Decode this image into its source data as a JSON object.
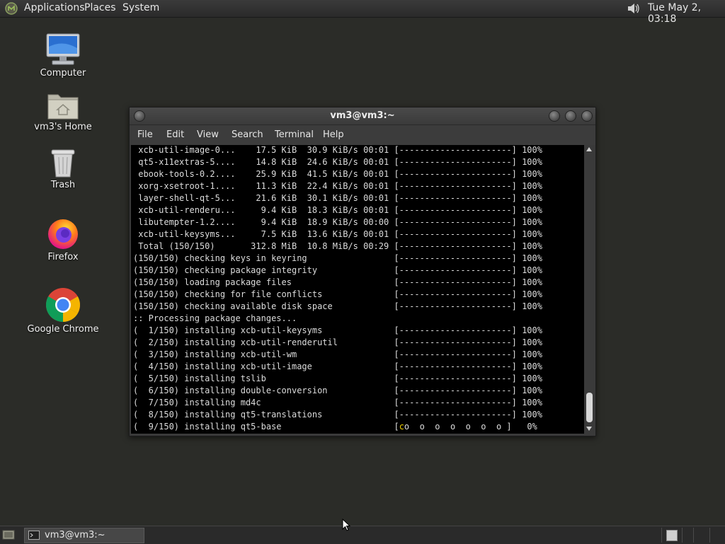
{
  "top_panel": {
    "menus": [
      "Applications",
      "Places",
      "System"
    ],
    "clock": "Tue May  2, 03:18"
  },
  "desktop_icons": [
    "Computer",
    "vm3's Home",
    "Trash",
    "Firefox",
    "Google Chrome"
  ],
  "window": {
    "title": "vm3@vm3:~",
    "menu": [
      "File",
      "Edit",
      "View",
      "Search",
      "Terminal",
      "Help"
    ],
    "lines": [
      " xcb-util-image-0...    17.5 KiB  30.9 KiB/s 00:01 [----------------------] 100%",
      " qt5-x11extras-5....    14.8 KiB  24.6 KiB/s 00:01 [----------------------] 100%",
      " ebook-tools-0.2....    25.9 KiB  41.5 KiB/s 00:01 [----------------------] 100%",
      " xorg-xsetroot-1....    11.3 KiB  22.4 KiB/s 00:01 [----------------------] 100%",
      " layer-shell-qt-5...    21.6 KiB  30.1 KiB/s 00:01 [----------------------] 100%",
      " xcb-util-renderu...     9.4 KiB  18.3 KiB/s 00:01 [----------------------] 100%",
      " libutempter-1.2....     9.4 KiB  18.9 KiB/s 00:00 [----------------------] 100%",
      " xcb-util-keysyms...     7.5 KiB  13.6 KiB/s 00:01 [----------------------] 100%",
      " Total (150/150)       312.8 MiB  10.8 MiB/s 00:29 [----------------------] 100%",
      "(150/150) checking keys in keyring                 [----------------------] 100%",
      "(150/150) checking package integrity               [----------------------] 100%",
      "(150/150) loading package files                    [----------------------] 100%",
      "(150/150) checking for file conflicts              [----------------------] 100%",
      "(150/150) checking available disk space            [----------------------] 100%",
      ":: Processing package changes...",
      "(  1/150) installing xcb-util-keysyms              [----------------------] 100%",
      "(  2/150) installing xcb-util-renderutil           [----------------------] 100%",
      "(  3/150) installing xcb-util-wm                   [----------------------] 100%",
      "(  4/150) installing xcb-util-image                [----------------------] 100%",
      "(  5/150) installing tslib                         [----------------------] 100%",
      "(  6/150) installing double-conversion             [----------------------] 100%",
      "(  7/150) installing md4c                          [----------------------] 100%",
      "(  8/150) installing qt5-translations              [----------------------] 100%",
      "(  9/150) installing qt5-base                      [co  o  o  o  o  o  o ]   0%"
    ]
  },
  "taskbar": {
    "task_label": "vm3@vm3:~"
  },
  "colors": {
    "terminal_bg": "#000000",
    "terminal_fg": "#dcdcdc",
    "pacman": "#f0d000"
  }
}
